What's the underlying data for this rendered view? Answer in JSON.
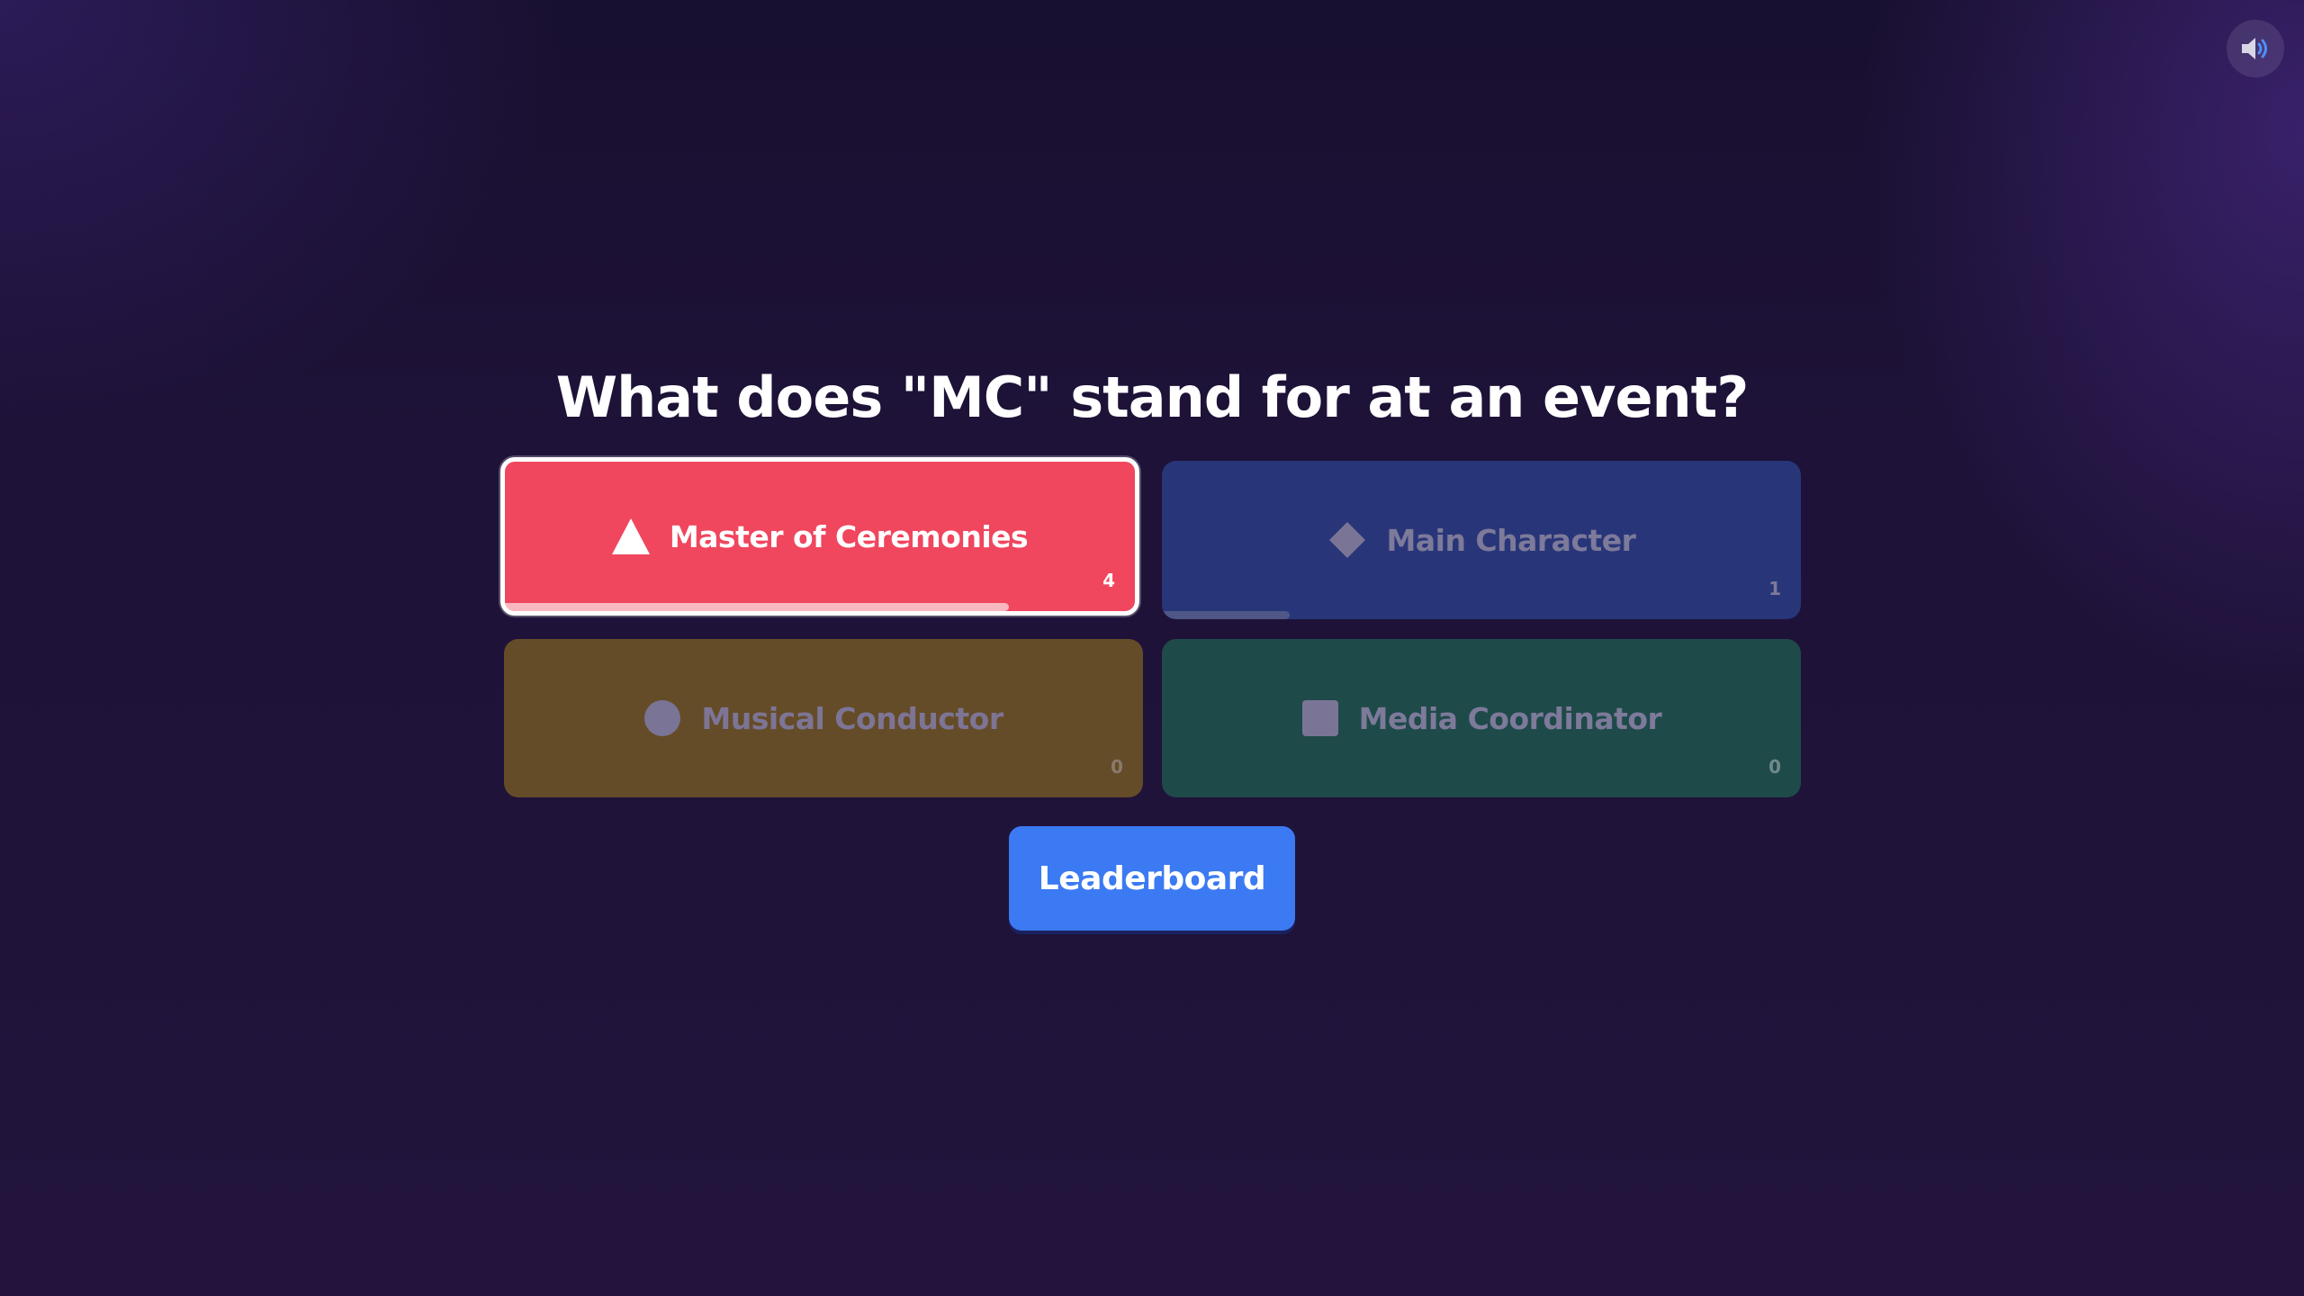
{
  "sound": {
    "icon": "speaker-icon",
    "accent": "#4f8ef7"
  },
  "question": {
    "text": "What does \"MC\" stand for at an event?"
  },
  "answers": [
    {
      "label": "Master of Ceremonies",
      "count": "4",
      "shape": "triangle-icon",
      "color": "#f0465e",
      "correct": true,
      "vote_fraction": 0.8
    },
    {
      "label": "Main Character",
      "count": "1",
      "shape": "diamond-icon",
      "color": "#283679",
      "correct": false,
      "vote_fraction": 0.2
    },
    {
      "label": "Musical Conductor",
      "count": "0",
      "shape": "circle-icon",
      "color": "#654c28",
      "correct": false,
      "vote_fraction": 0
    },
    {
      "label": "Media Coordinator",
      "count": "0",
      "shape": "square-icon",
      "color": "#1f4a4a",
      "correct": false,
      "vote_fraction": 0
    }
  ],
  "leaderboard": {
    "label": "Leaderboard",
    "color": "#3b7af2"
  }
}
